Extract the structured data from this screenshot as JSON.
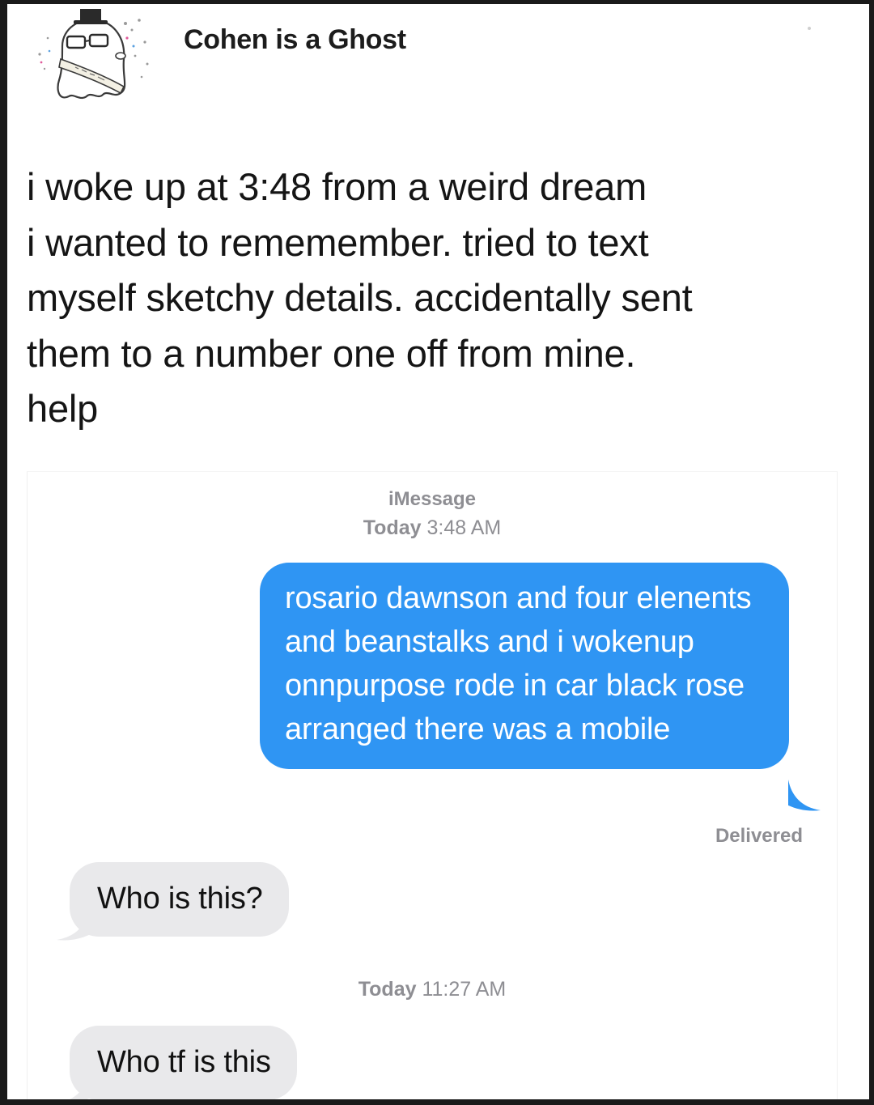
{
  "post": {
    "username": "Cohen is a Ghost",
    "text": "i woke up at 3:48 from a weird dream\ni wanted to rememember. tried to text\nmyself sketchy details. accidentally sent\nthem to a number one off from mine.\nhelp"
  },
  "conversation": {
    "service": "iMessage",
    "timestamp_1_day": "Today",
    "timestamp_1_time": "3:48 AM",
    "sent_message": "rosario dawnson and four elenents and beanstalks and i wokenup onnpurpose rode in car black rose arranged there was a mobile",
    "delivered_label": "Delivered",
    "received_1": "Who is this?",
    "timestamp_2_day": "Today",
    "timestamp_2_time": "11:27 AM",
    "received_2": "Who tf is this"
  },
  "colors": {
    "sent_bubble": "#2f95f3",
    "received_bubble": "#e9e9eb",
    "meta_text": "#8e8e93"
  },
  "icons": {
    "avatar": "ghost-with-glasses-and-top-hat-avatar"
  }
}
